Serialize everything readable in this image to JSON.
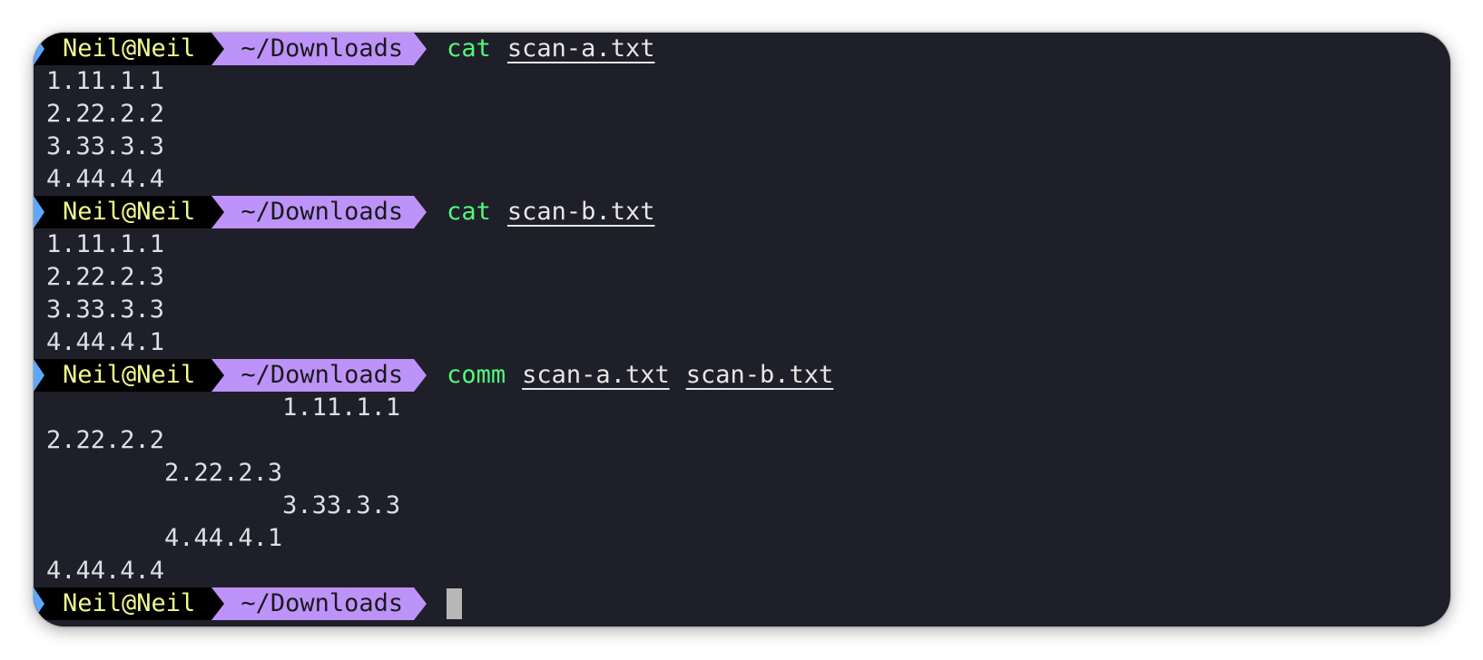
{
  "prompt": {
    "user": "Neil@Neil",
    "path": "~/Downloads"
  },
  "blocks": [
    {
      "command": "cat",
      "args": [
        "scan-a.txt"
      ],
      "output": [
        "1.11.1.1",
        "2.22.2.2",
        "3.33.3.3",
        "4.44.4.4"
      ]
    },
    {
      "command": "cat",
      "args": [
        "scan-b.txt"
      ],
      "output": [
        "1.11.1.1",
        "2.22.2.3",
        "3.33.3.3",
        "4.44.4.1"
      ]
    },
    {
      "command": "comm",
      "args": [
        "scan-a.txt",
        "scan-b.txt"
      ],
      "output": [
        "                1.11.1.1",
        "2.22.2.2",
        "        2.22.2.3",
        "                3.33.3.3",
        "        4.44.4.1",
        "4.44.4.4"
      ]
    }
  ],
  "colors": {
    "background": "#1f1f29",
    "user_fg": "#f1fa8c",
    "path_bg": "#bd93f9",
    "command": "#50fa7b",
    "text": "#dcdfe4"
  }
}
